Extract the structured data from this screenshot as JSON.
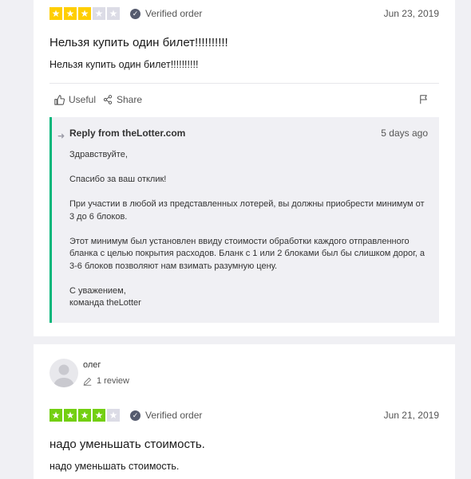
{
  "colors": {
    "star_red": "#ff3722",
    "star_yellow": "#ffce00",
    "star_green": "#73cf11",
    "star_empty": "#dcdce6",
    "reply_border": "#00b67a"
  },
  "reviews": [
    {
      "rating": 3,
      "rating_color": "#ffce00",
      "verified_label": "Verified order",
      "date": "Jun 23, 2019",
      "title": "Нельзя купить один билет!!!!!!!!!!",
      "body": "Нельзя купить один билет!!!!!!!!!!",
      "actions": {
        "useful": "Useful",
        "share": "Share"
      },
      "reply": {
        "title": "Reply from theLotter.com",
        "date": "5 days ago",
        "text": "Здравствуйте,\n\nСпасибо за ваш отклик!\n\nПри участии в любой из представленных лотерей, вы должны приобрести минимум от 3 до 6 блоков.\n\nЭтот минимум был установлен ввиду стоимости обработки каждого отправленного бланка с целью покрытия расходов. Бланк с 1 или 2 блоками был бы слишком дорог, а 3-6 блоков позволяют нам взимать разумную цену.\n\nС уважением,\nкоманда theLotter"
      }
    },
    {
      "user": "олег",
      "reviews_count": "1 review",
      "rating": 4,
      "rating_color": "#73cf11",
      "verified_label": "Verified order",
      "date": "Jun 21, 2019",
      "title": "надо уменьшать стоимость.",
      "body": "надо уменьшать стоимость."
    }
  ]
}
